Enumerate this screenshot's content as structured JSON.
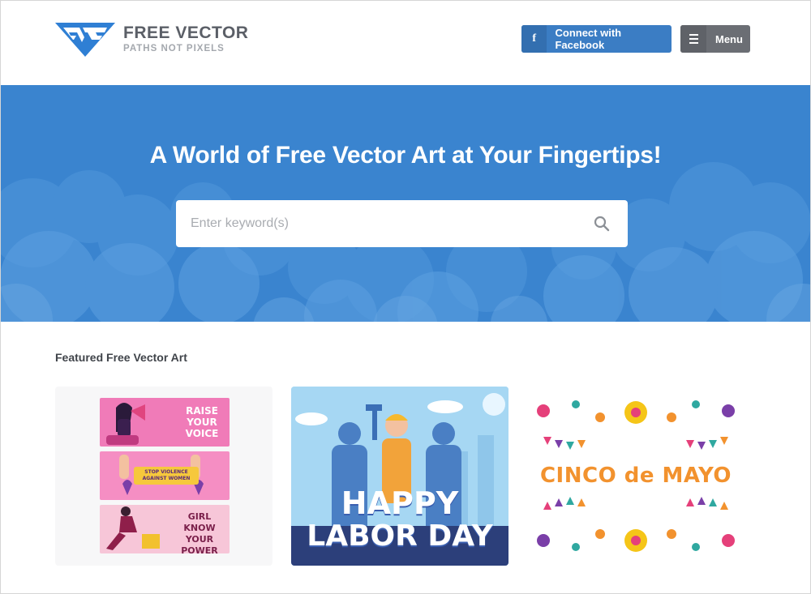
{
  "brand": {
    "title": "FREE VECTOR",
    "tagline": "PATHS NOT PIXELS",
    "accent": "#2f7fd4"
  },
  "header": {
    "facebook_label": "Connect with Facebook",
    "facebook_icon": "f",
    "menu_label": "Menu"
  },
  "hero": {
    "title": "A World of Free Vector Art at Your Fingertips!",
    "background_color": "#3a84cf"
  },
  "search": {
    "placeholder": "Enter keyword(s)",
    "value": ""
  },
  "featured": {
    "heading": "Featured Free Vector Art",
    "cards": [
      {
        "name": "womens-rights-banners",
        "banner1": [
          "RAISE",
          "YOUR",
          "VOICE"
        ],
        "banner2_pill": [
          "STOP VIOLENCE",
          "AGAINST WOMEN"
        ],
        "banner3": [
          "GIRL",
          "KNOW YOUR",
          "POWER"
        ]
      },
      {
        "name": "labor-day",
        "line1": "HAPPY",
        "line2": "LABOR DAY"
      },
      {
        "name": "cinco-de-mayo",
        "text": "CINCO de MAYO"
      }
    ]
  }
}
